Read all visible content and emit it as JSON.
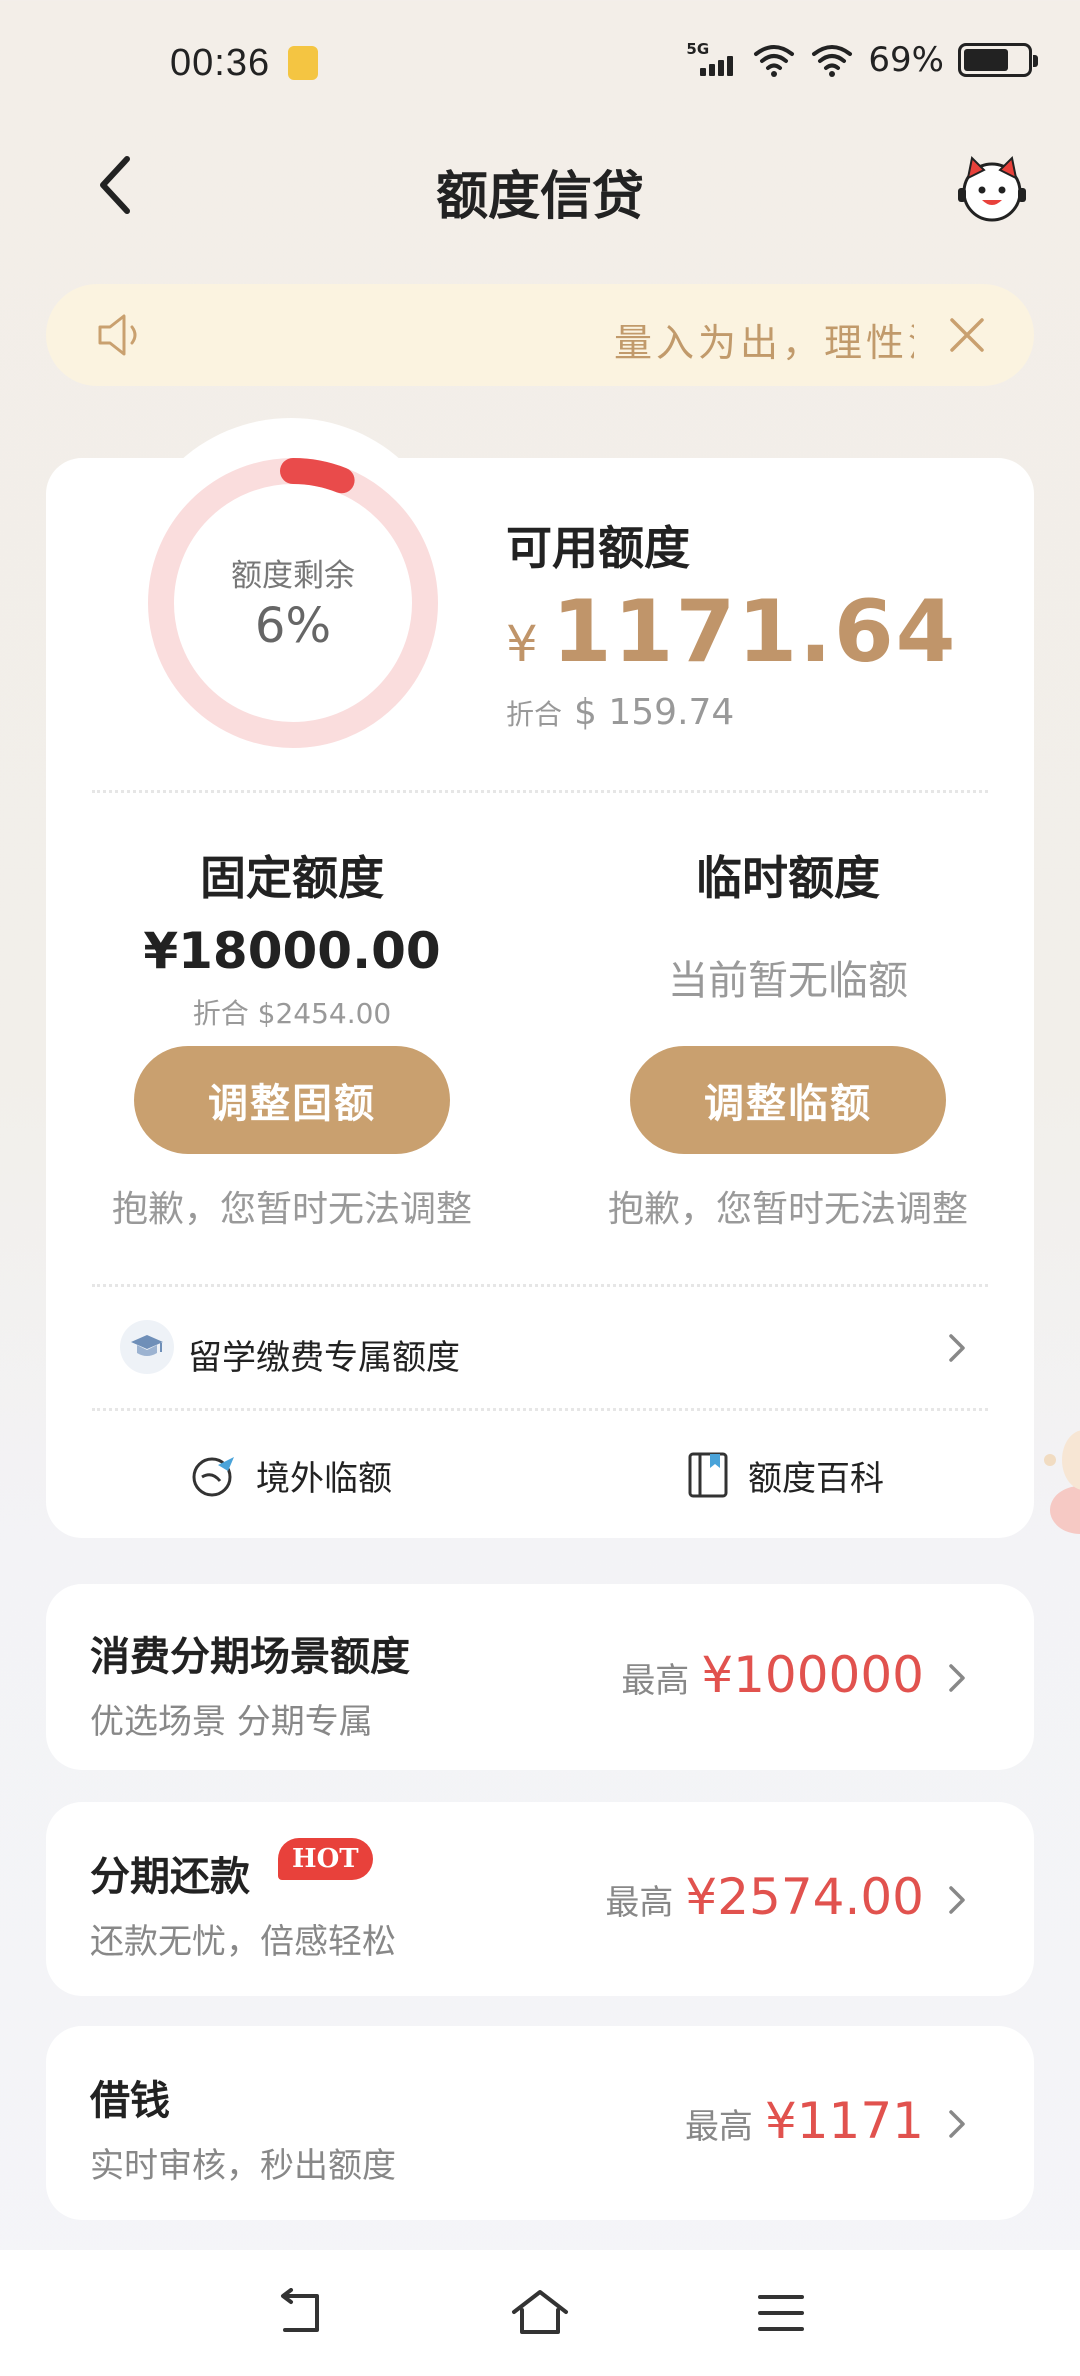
{
  "status_bar": {
    "time": "00:36",
    "network": "5G",
    "battery": "69%"
  },
  "header": {
    "title": "额度信贷"
  },
  "notice": {
    "text": "量入为出，理性消费"
  },
  "quota_ring": {
    "label": "额度剩余",
    "value": "6%",
    "fraction": 0.06
  },
  "available": {
    "title": "可用额度",
    "currency": "¥",
    "amount": "1171.64",
    "converted_label": "折合",
    "converted_value": "$ 159.74"
  },
  "fixed": {
    "title": "固定额度",
    "amount": "¥18000.00",
    "converted": "折合 $2454.00",
    "button": "调整固额",
    "note": "抱歉，您暂时无法调整"
  },
  "temporary": {
    "title": "临时额度",
    "status": "当前暂无临额",
    "button": "调整临额",
    "note": "抱歉，您暂时无法调整"
  },
  "study_row": {
    "label": "留学缴费专属额度"
  },
  "quick_links": {
    "overseas": "境外临额",
    "wiki": "额度百科"
  },
  "list": [
    {
      "title": "消费分期场景额度",
      "subtitle": "优选场景 分期专属",
      "max_label": "最高",
      "max_value": "¥100000"
    },
    {
      "title": "分期还款",
      "badge": "HOT",
      "subtitle": "还款无忧，倍感轻松",
      "max_label": "最高",
      "max_value": "¥2574.00"
    },
    {
      "title": "借钱",
      "subtitle": "实时审核，秒出额度",
      "max_label": "最高",
      "max_value": "¥1171"
    }
  ],
  "colors": {
    "gold": "#c9a06f",
    "amount_gold": "#c0956a",
    "red": "#e1524e",
    "hot_badge": "#e8413b",
    "ring_track": "#fadddd",
    "ring_fill": "#e94b4b",
    "notice_bg": "#fbf3e0"
  },
  "icons": [
    "back-arrow-icon",
    "customer-service-icon",
    "speaker-icon",
    "close-icon",
    "graduation-cap-icon",
    "chevron-right-icon",
    "globe-plane-icon",
    "book-icon",
    "nav-back-icon",
    "nav-home-icon",
    "nav-menu-icon"
  ]
}
